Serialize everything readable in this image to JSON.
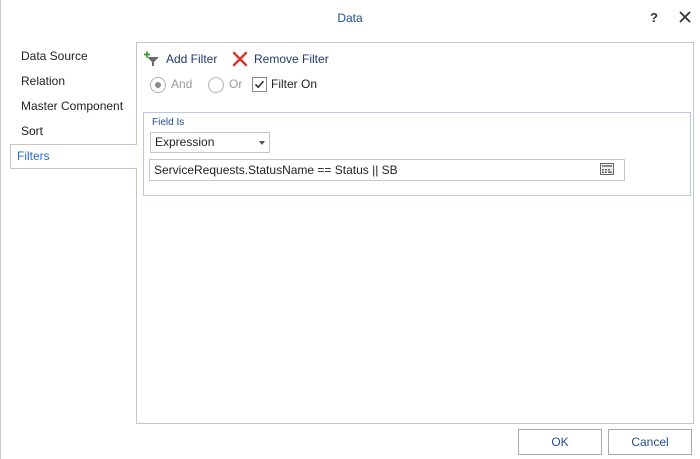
{
  "window": {
    "title": "Data",
    "help_glyph": "?"
  },
  "sidebar": {
    "items": [
      {
        "label": "Data Source",
        "selected": false
      },
      {
        "label": "Relation",
        "selected": false
      },
      {
        "label": "Master Component",
        "selected": false
      },
      {
        "label": "Sort",
        "selected": false
      },
      {
        "label": "Filters",
        "selected": true
      }
    ]
  },
  "toolbar": {
    "add_filter_label": "Add Filter",
    "add_filter_icon": "funnel-plus-icon",
    "remove_filter_label": "Remove Filter",
    "remove_filter_icon": "red-x-icon"
  },
  "options": {
    "and_label": "And",
    "and_selected": true,
    "or_label": "Or",
    "or_selected": false,
    "filter_on_label": "Filter On",
    "filter_on_checked": true
  },
  "filter": {
    "field_is_label": "Field Is",
    "field_type_value": "Expression",
    "expression_value": "ServiceRequests.StatusName == Status || SB",
    "expression_button_icon": "expression-editor-icon"
  },
  "footer": {
    "ok_label": "OK",
    "cancel_label": "Cancel"
  },
  "colors": {
    "accent": "#1f4e8c",
    "selected_nav": "#2a6bc0",
    "remove_icon": "#d9362b",
    "add_icon_plus": "#3a9a3a"
  }
}
